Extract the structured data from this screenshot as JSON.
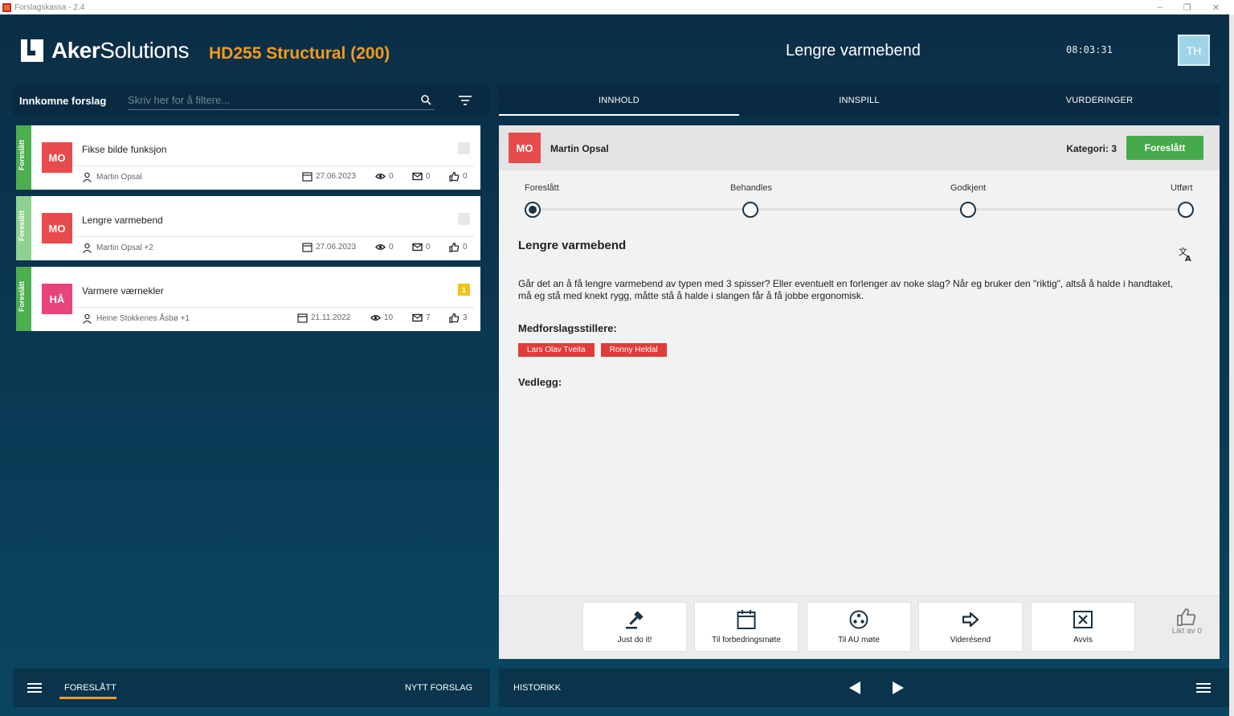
{
  "window": {
    "title": "Forslagskassa - 2.4",
    "controls": [
      "–",
      "❐",
      "✕"
    ]
  },
  "header": {
    "logo_bold": "Aker",
    "logo_light": "Solutions",
    "project": "HD255 Structural (200)",
    "title": "Lengre varmebend",
    "clock": "08:03:31",
    "user_initials": "TH"
  },
  "left": {
    "label": "Innkomne forslag",
    "search_placeholder": "Skriv her for å filtere...",
    "cards": [
      {
        "status": "Foreslått",
        "initials": "MO",
        "title": "Fikse bilde funksjon",
        "author": "Martin Opsal",
        "date": "27.06.2023",
        "views": "0",
        "messages": "0",
        "likes": "0",
        "flag": ""
      },
      {
        "status": "Foreslått",
        "initials": "MO",
        "title": "Lengre varmebend",
        "author": "Martin Opsal +2",
        "date": "27.06.2023",
        "views": "0",
        "messages": "0",
        "likes": "0",
        "flag": ""
      },
      {
        "status": "Foreslått",
        "initials": "HÅ",
        "title": "Varmere værnekler",
        "author": "Heine Stokkenes Åsbø +1",
        "date": "21.11.2022",
        "views": "10",
        "messages": "7",
        "likes": "3",
        "flag": "1"
      }
    ]
  },
  "tabs": [
    "INNHOLD",
    "INNSPILL",
    "VURDERINGER"
  ],
  "detail": {
    "initials": "MO",
    "name": "Martin Opsal",
    "category": "Kategori: 3",
    "status_button": "Foreslått",
    "steps": [
      "Foreslått",
      "Behandles",
      "Godkjent",
      "Utført"
    ],
    "current_step": 0,
    "title": "Lengre varmebend",
    "body": "Går det an å få lengre varmebend av typen med 3 spisser? Eller eventuelt en forlenger av noke slag? Når eg bruker den \"riktig\", altså å halde i handtaket, må eg stå med knekt rygg, måtte stå å halde i slangen får å få jobbe ergonomisk.",
    "co_label": "Medforslagsstillere:",
    "co_authors": [
      "Lars Olav Tveita",
      "Ronny Heldal"
    ],
    "attachments_label": "Vedlegg:",
    "actions": [
      "Just do it!",
      "Til forbedringsmøte",
      "Til AU møte",
      "Viderésend",
      "Avvis"
    ],
    "likes_label": "Likt av 0"
  },
  "bottom": {
    "tab_proposed": "FORESLÅTT",
    "new_proposal": "NYTT FORSLAG",
    "history": "HISTORIKK"
  },
  "colors": {
    "accent": "#f29b1c",
    "status_green": "#45ab4a",
    "avatar_red": "#e84b4b",
    "avatar_pink": "#e8437a",
    "flag_yellow": "#f3c21b"
  }
}
